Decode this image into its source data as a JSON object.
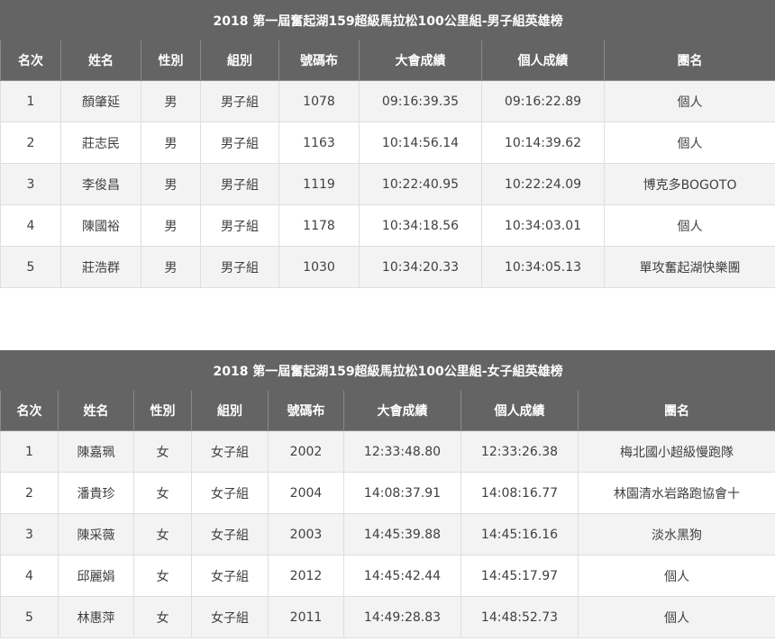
{
  "men_board": {
    "title": "2018 第一屆奮起湖159超級馬拉松100公里組-男子組英雄榜",
    "headers": [
      "名次",
      "姓名",
      "性別",
      "組別",
      "號碼布",
      "大會成績",
      "個人成績",
      "團名"
    ],
    "rows": [
      [
        "1",
        "顏肇延",
        "男",
        "男子組",
        "1078",
        "09:16:39.35",
        "09:16:22.89",
        "個人"
      ],
      [
        "2",
        "莊志民",
        "男",
        "男子組",
        "1163",
        "10:14:56.14",
        "10:14:39.62",
        "個人"
      ],
      [
        "3",
        "李俊昌",
        "男",
        "男子組",
        "1119",
        "10:22:40.95",
        "10:22:24.09",
        "博克多BOGOTO"
      ],
      [
        "4",
        "陳國裕",
        "男",
        "男子組",
        "1178",
        "10:34:18.56",
        "10:34:03.01",
        "個人"
      ],
      [
        "5",
        "莊浩群",
        "男",
        "男子組",
        "1030",
        "10:34:20.33",
        "10:34:05.13",
        "單攻奮起湖快樂團"
      ]
    ]
  },
  "women_board": {
    "title": "2018 第一屆奮起湖159超級馬拉松100公里組-女子組英雄榜",
    "headers": [
      "名次",
      "姓名",
      "性別",
      "組別",
      "號碼布",
      "大會成績",
      "個人成績",
      "團名"
    ],
    "rows": [
      [
        "1",
        "陳嘉珮",
        "女",
        "女子組",
        "2002",
        "12:33:48.80",
        "12:33:26.38",
        "梅北國小超級慢跑隊"
      ],
      [
        "2",
        "潘貴珍",
        "女",
        "女子組",
        "2004",
        "14:08:37.91",
        "14:08:16.77",
        "林園清水岩路跑協會十"
      ],
      [
        "3",
        "陳采薇",
        "女",
        "女子組",
        "2003",
        "14:45:39.88",
        "14:45:16.16",
        "淡水黑狗"
      ],
      [
        "4",
        "邱麗娟",
        "女",
        "女子組",
        "2012",
        "14:45:42.44",
        "14:45:17.97",
        "個人"
      ],
      [
        "5",
        "林惠萍",
        "女",
        "女子組",
        "2011",
        "14:49:28.83",
        "14:48:52.73",
        "個人"
      ]
    ]
  }
}
